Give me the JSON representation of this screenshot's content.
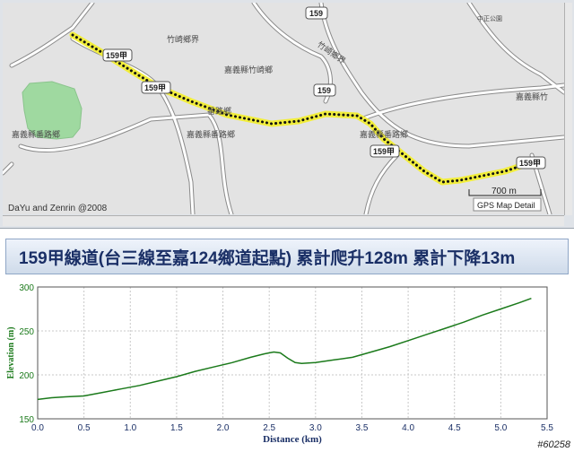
{
  "map": {
    "place_labels": [
      {
        "name": "label-tingtse-village-top",
        "text": "竹崎鄉界"
      },
      {
        "name": "label-jiayi-zhuqi",
        "text": "嘉義縣竹崎鄉"
      },
      {
        "name": "label-fanlu-north",
        "text": "番路鄉"
      },
      {
        "name": "label-jiayi-fanlu-center",
        "text": "嘉義縣番路鄉"
      },
      {
        "name": "label-jiayi-fanlu-left",
        "text": "嘉義縣番路鄉"
      },
      {
        "name": "label-jiayi-fanlu-right",
        "text": "嘉義縣番路鄉"
      },
      {
        "name": "label-zhuqi-diagonal",
        "text": "竹崎鄉界"
      },
      {
        "name": "label-jiayi-zhuqi-right",
        "text": "嘉義縣竹"
      },
      {
        "name": "label-park",
        "text": "中正公園"
      }
    ],
    "route_shields": [
      {
        "name": "shield-159-top",
        "text": "159"
      },
      {
        "name": "shield-159jia-1",
        "text": "159甲"
      },
      {
        "name": "shield-159jia-2",
        "text": "159甲"
      },
      {
        "name": "shield-159-mid",
        "text": "159"
      },
      {
        "name": "shield-159jia-3",
        "text": "159甲"
      },
      {
        "name": "shield-159jia-4",
        "text": "159甲"
      }
    ],
    "copyright": "DaYu and  Zenrin @2008",
    "scale_label": "700 m",
    "source_label": "GPS Map Detail",
    "colors": {
      "land": "#e2e2e2",
      "road": "#ffffff",
      "road_edge": "#8a8a8a",
      "park": "#9fd9a0",
      "route": "#f2ee3c",
      "route_dots": "#111111"
    }
  },
  "chart_title": "159甲線道(台三線至嘉124鄉道起點)  累計爬升128m 累計下降13m",
  "chart_data": {
    "type": "line",
    "xlabel": "Distance (km)",
    "ylabel": "Elevation  (m)",
    "xlim": [
      0,
      5.5
    ],
    "ylim": [
      150,
      300
    ],
    "xticks": [
      0.0,
      0.5,
      1.0,
      1.5,
      2.0,
      2.5,
      3.0,
      3.5,
      4.0,
      4.5,
      5.0,
      5.5
    ],
    "yticks": [
      150,
      200,
      250,
      300
    ],
    "grid": true,
    "line_color": "#1b7a1b",
    "series": [
      {
        "x": [
          0.0,
          0.15,
          0.3,
          0.5,
          0.7,
          0.9,
          1.1,
          1.3,
          1.5,
          1.7,
          1.9,
          2.1,
          2.3,
          2.45,
          2.55,
          2.62,
          2.7,
          2.78,
          2.85,
          3.0,
          3.2,
          3.4,
          3.6,
          3.8,
          4.0,
          4.2,
          4.4,
          4.6,
          4.8,
          5.0,
          5.2,
          5.33
        ],
        "y": [
          172,
          174,
          175,
          176,
          180,
          184,
          188,
          193,
          198,
          204,
          209,
          214,
          220,
          224,
          226,
          225,
          219,
          214,
          213,
          214,
          217,
          220,
          226,
          232,
          239,
          246,
          253,
          260,
          268,
          275,
          282,
          287
        ]
      }
    ]
  },
  "watermark": "#60258"
}
